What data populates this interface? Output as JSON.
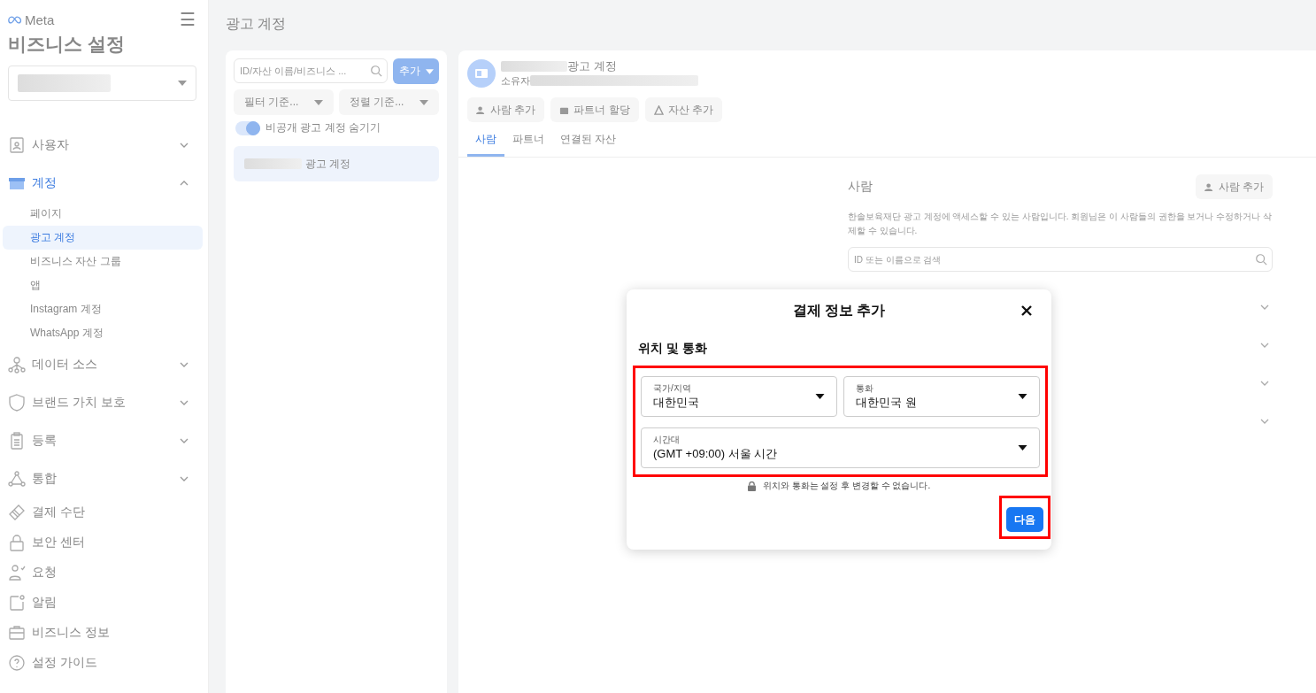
{
  "sidebar": {
    "brand": "Meta",
    "title": "비즈니스 설정",
    "menu_icon": "☰",
    "items": [
      {
        "kind": "group",
        "label": "사용자",
        "expanded": false,
        "selected": false
      },
      {
        "kind": "group",
        "label": "계정",
        "expanded": true,
        "selected": true,
        "children": [
          {
            "label": "페이지",
            "selected": false
          },
          {
            "label": "광고 계정",
            "selected": true
          },
          {
            "label": "비즈니스 자산 그룹",
            "selected": false
          },
          {
            "label": "앱",
            "selected": false
          },
          {
            "label": "Instagram 계정",
            "selected": false
          },
          {
            "label": "WhatsApp 계정",
            "selected": false
          }
        ]
      },
      {
        "kind": "group",
        "label": "데이터 소스",
        "expanded": false,
        "selected": false
      },
      {
        "kind": "group",
        "label": "브랜드 가치 보호",
        "expanded": false,
        "selected": false
      },
      {
        "kind": "group",
        "label": "등록",
        "expanded": false,
        "selected": false
      },
      {
        "kind": "group",
        "label": "통합",
        "expanded": false,
        "selected": false
      },
      {
        "kind": "link",
        "label": "결제 수단",
        "selected": false
      },
      {
        "kind": "link",
        "label": "보안 센터",
        "selected": false
      },
      {
        "kind": "link",
        "label": "요청",
        "selected": false
      },
      {
        "kind": "link",
        "label": "알림",
        "selected": false
      },
      {
        "kind": "link",
        "label": "비즈니스 정보",
        "selected": false
      },
      {
        "kind": "link",
        "label": "설정 가이드",
        "selected": false
      }
    ]
  },
  "page_title": "광고 계정",
  "list_panel": {
    "search": {
      "placeholder": "ID/자산 이름/비즈니스 ..."
    },
    "add_button": "추가",
    "filter": "필터 기준...",
    "sort": "정렬 기준...",
    "toggle": {
      "label": "비공개 광고 계정 숨기기",
      "on": true
    },
    "items": [
      {
        "label": "광고 계정",
        "selected": true
      }
    ]
  },
  "detail": {
    "title": "광고 계정",
    "owner_label": "소유자",
    "actions": [
      "사람 추가",
      "파트너 할당",
      "자산 추가"
    ],
    "tabs": [
      {
        "label": "사람",
        "selected": true
      },
      {
        "label": "파트너",
        "selected": false
      },
      {
        "label": "연결된 자산",
        "selected": false
      }
    ],
    "people": {
      "heading": "사람",
      "add_button": "사람 추가",
      "description": "한솔보육재단 광고 계정에 액세스할 수 있는 사람입니다. 회원님은 이 사람들의 권한을 보거나 수정하거나 삭제할 수 있습니다.",
      "search": {
        "placeholder": "ID 또는 이름으로 검색"
      },
      "rows": [
        {
          "expanded": false
        },
        {
          "expanded": false
        },
        {
          "expanded": false
        },
        {
          "expanded": false
        }
      ]
    }
  },
  "dialog": {
    "title": "결제 정보 추가",
    "section": "위치 및 통화",
    "highlighted": true,
    "fields": [
      {
        "label": "국가/지역",
        "value": "대한민국"
      },
      {
        "label": "통화",
        "value": "대한민국 원"
      },
      {
        "label": "시간대",
        "value": "(GMT +09:00) 서울 시간"
      }
    ],
    "notice": "위치와 통화는 설정 후 변경할 수 없습니다.",
    "next_button": {
      "label": "다음",
      "highlighted": true
    }
  }
}
